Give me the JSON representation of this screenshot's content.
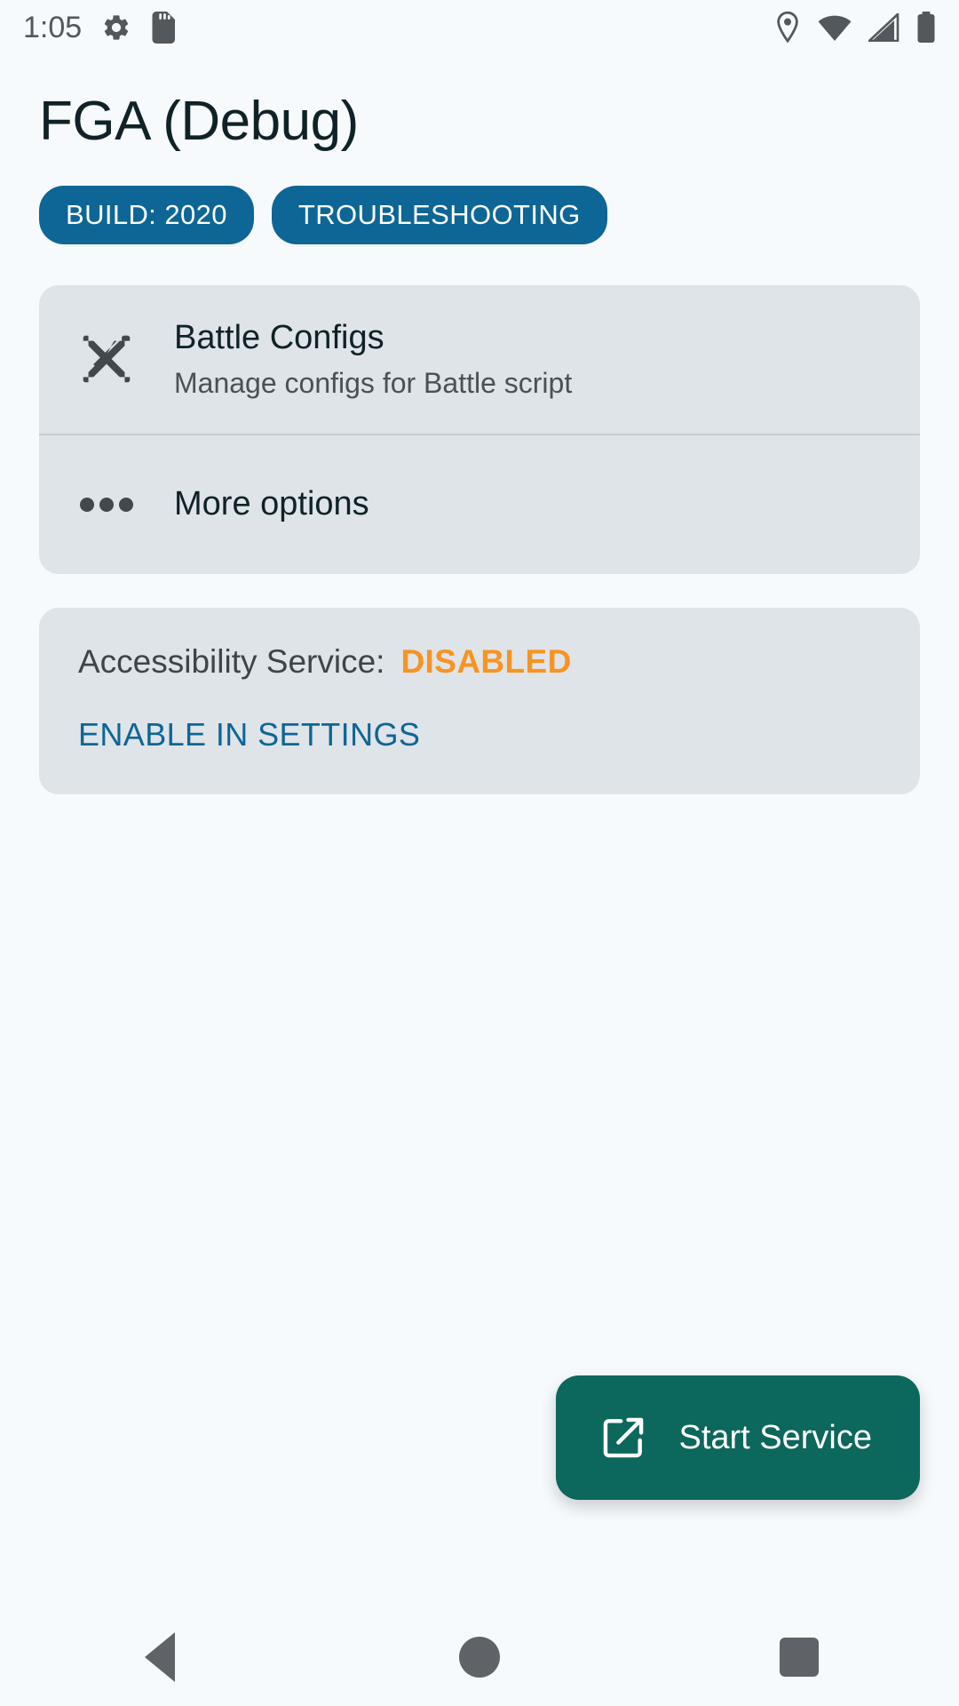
{
  "status_bar": {
    "time": "1:05",
    "left_icons": [
      {
        "name": "settings-gear-icon",
        "glyph": "gear"
      },
      {
        "name": "sd-card-icon",
        "glyph": "sd-card"
      }
    ],
    "right_icons": [
      {
        "name": "location-pin-icon",
        "glyph": "location"
      },
      {
        "name": "wifi-icon",
        "glyph": "wifi"
      },
      {
        "name": "cellular-signal-icon",
        "glyph": "signal"
      },
      {
        "name": "battery-icon",
        "glyph": "battery"
      }
    ]
  },
  "app": {
    "title": "FGA (Debug)",
    "chips": [
      {
        "label": "BUILD: 2020"
      },
      {
        "label": "TROUBLESHOOTING"
      }
    ]
  },
  "menu_card": {
    "battle_configs": {
      "title": "Battle Configs",
      "subtitle": "Manage configs for Battle script",
      "icon": "crossed-swords-icon"
    },
    "more_options": {
      "title": "More options",
      "icon": "more-horizontal-icon"
    }
  },
  "service_card": {
    "label": "Accessibility Service:",
    "value": "DISABLED",
    "action": "ENABLE IN SETTINGS"
  },
  "fab": {
    "label": "Start Service",
    "icon": "open-in-new-icon"
  },
  "nav_bar": {
    "back": "Back",
    "home": "Home",
    "recents": "Recents"
  },
  "colors": {
    "background": "#f6fafd",
    "card": "#dfe4e9",
    "chip": "#0d6695",
    "accent_link": "#0d6695",
    "status_warn": "#f79421",
    "fab": "#0c675c",
    "title": "#0f2227"
  }
}
